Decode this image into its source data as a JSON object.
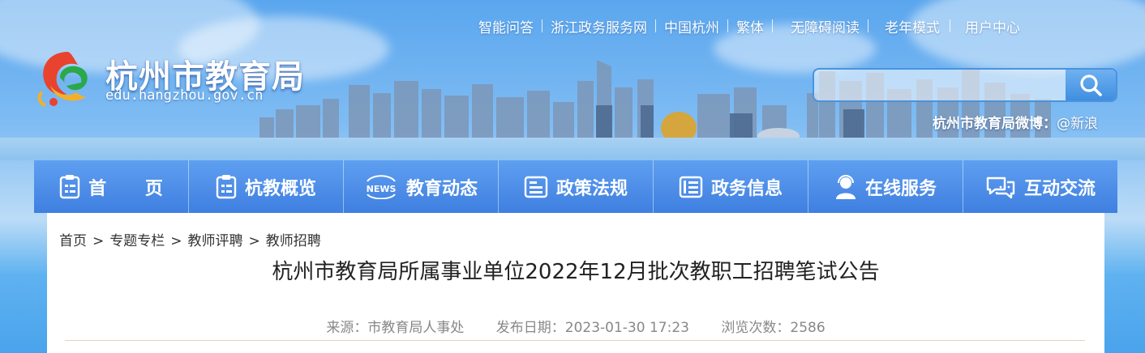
{
  "header": {
    "top_links": [
      "智能问答",
      "浙江政务服务网",
      "中国杭州",
      "繁体",
      "无障碍阅读",
      "老年模式",
      "用户中心"
    ],
    "site_title": "杭州市教育局",
    "site_url": "edu.hangzhou.gov.cn",
    "search_placeholder": "",
    "weibo_label": "杭州市教育局微博：",
    "weibo_link": "@新浪"
  },
  "nav": {
    "items": [
      {
        "label": "首 页",
        "icon": "home-doc-icon"
      },
      {
        "label": "杭教概览",
        "icon": "clipboard-icon"
      },
      {
        "label": "教育动态",
        "icon": "news-icon"
      },
      {
        "label": "政策法规",
        "icon": "policy-doc-icon"
      },
      {
        "label": "政务信息",
        "icon": "info-doc-icon"
      },
      {
        "label": "在线服务",
        "icon": "service-person-icon"
      },
      {
        "label": "互动交流",
        "icon": "chat-bubbles-icon"
      }
    ]
  },
  "breadcrumb": [
    "首页",
    "专题专栏",
    "教师评聘",
    "教师招聘"
  ],
  "article": {
    "title": "杭州市教育局所属事业单位2022年12月批次教职工招聘笔试公告",
    "source": "来源：市教育局人事处",
    "date": "发布日期：2023-01-30 17:23",
    "views": "浏览次数：2586"
  },
  "colors": {
    "nav_bg": "#4f8fe8",
    "sky": "#6fb3f0",
    "text": "#222222",
    "meta": "#888888"
  }
}
